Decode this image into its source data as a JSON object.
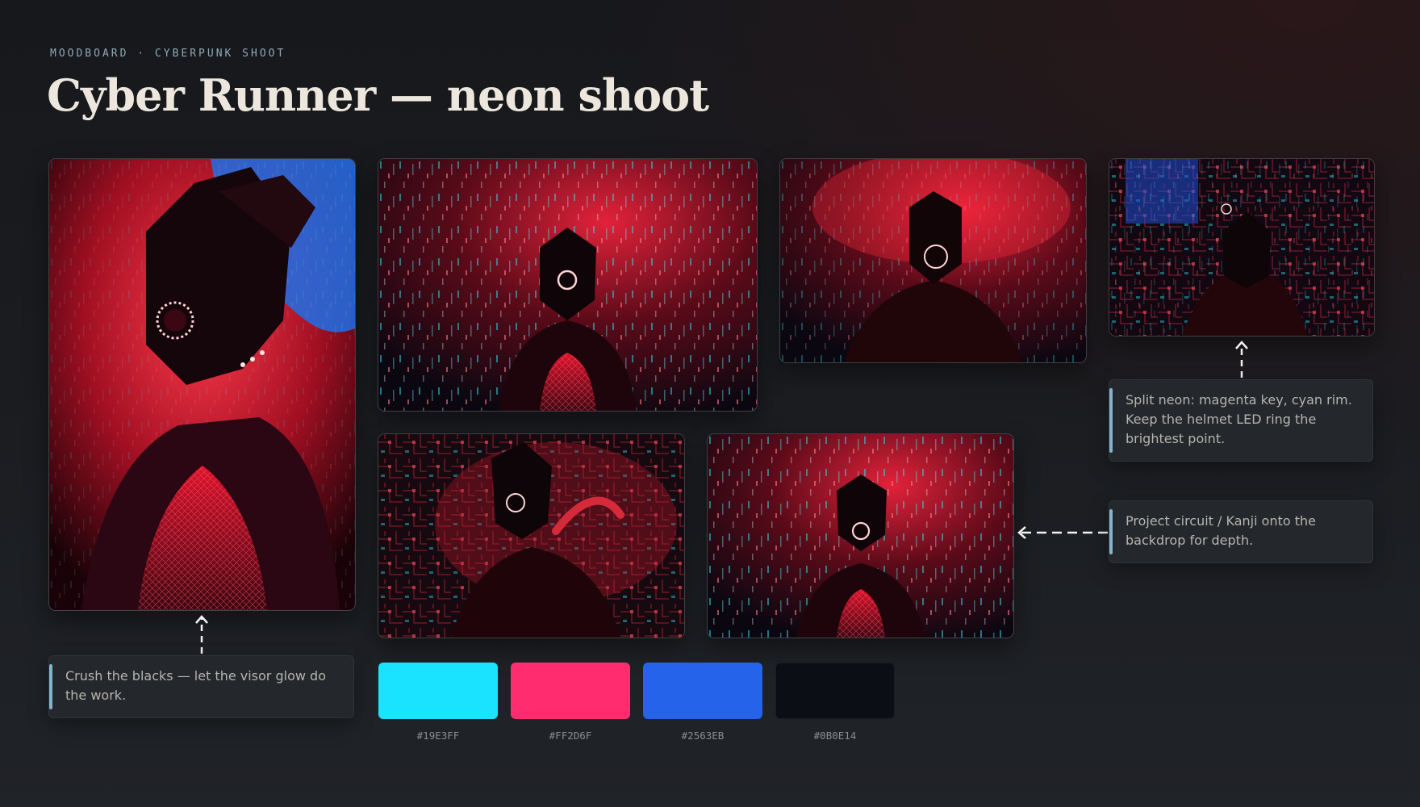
{
  "header": {
    "eyebrow": "MOODBOARD · CYBERPUNK SHOOT",
    "title": "Cyber Runner — neon shoot"
  },
  "notes": {
    "blacks": "Crush the blacks — let the visor glow do the work.",
    "split_neon": "Split neon: magenta key, cyan rim. Keep the helmet LED ring the brightest point.",
    "project": "Project circuit / Kanji onto the backdrop for depth."
  },
  "swatches": [
    {
      "hex": "#19E3FF",
      "label": "#19E3FF"
    },
    {
      "hex": "#FF2D6F",
      "label": "#FF2D6F"
    },
    {
      "hex": "#2563EB",
      "label": "#2563EB"
    },
    {
      "hex": "#0B0E14",
      "label": "#0B0E14"
    }
  ],
  "colors": {
    "accent_bar": "#7fb5cf",
    "neon_red": "#ff2a3c",
    "neon_cyan": "#19E3FF",
    "neon_blue": "#2563EB"
  },
  "icons": {
    "arrow": "arrow-up-icon"
  }
}
